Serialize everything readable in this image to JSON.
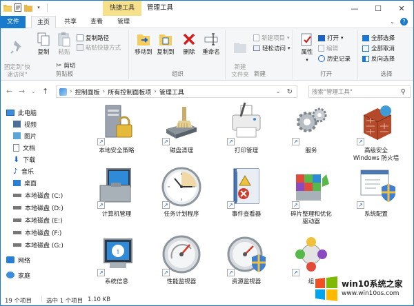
{
  "titlebar": {
    "context_tab": "快捷工具",
    "window_title": "管理工具"
  },
  "tabs": {
    "file": "文件",
    "home": "主页",
    "share": "共享",
    "view": "查看",
    "manage": "管理"
  },
  "ribbon": {
    "clipboard": {
      "pin": "固定到\"快\n速访问\"",
      "copy": "复制",
      "paste": "粘贴",
      "copy_path": "复制路径",
      "paste_shortcut": "粘贴快捷方式",
      "cut": "剪切",
      "label": "剪贴板"
    },
    "organize": {
      "move_to": "移动到",
      "copy_to": "复制到",
      "delete": "删除",
      "rename": "重命名",
      "label": "组织"
    },
    "new": {
      "new_folder": "新建\n文件夹",
      "new_item": "新建项目",
      "easy_access": "轻松访问",
      "label": "新建"
    },
    "open": {
      "properties": "属性",
      "open": "打开",
      "edit": "编辑",
      "history": "历史记录",
      "label": "打开"
    },
    "select": {
      "select_all": "全部选择",
      "select_none": "全部取消",
      "invert": "反向选择",
      "label": "选择"
    }
  },
  "address": {
    "crumbs": [
      "控制面板",
      "所有控制面板项",
      "管理工具"
    ],
    "search_placeholder": "搜索\"管理工具\""
  },
  "nav": {
    "items": [
      "此电脑",
      "视频",
      "图片",
      "文档",
      "下载",
      "音乐",
      "桌面",
      "本地磁盘 (C:)",
      "本地磁盘 (D:)",
      "本地磁盘 (E:)",
      "本地磁盘 (F:)",
      "本地磁盘 (G:)",
      "网络",
      "家庭"
    ]
  },
  "items": [
    {
      "label": "本地安全策略",
      "icon": "security-policy-icon"
    },
    {
      "label": "磁盘清理",
      "icon": "disk-cleanup-icon"
    },
    {
      "label": "打印管理",
      "icon": "print-management-icon"
    },
    {
      "label": "服务",
      "icon": "services-icon"
    },
    {
      "label": "高级安全\nWindows 防火墙",
      "icon": "firewall-icon"
    },
    {
      "label": "计算机管理",
      "icon": "computer-management-icon"
    },
    {
      "label": "任务计划程序",
      "icon": "task-scheduler-icon"
    },
    {
      "label": "事件查看器",
      "icon": "event-viewer-icon"
    },
    {
      "label": "碎片整理和优化\n驱动器",
      "icon": "defrag-icon"
    },
    {
      "label": "系统配置",
      "icon": "system-config-icon"
    },
    {
      "label": "系统信息",
      "icon": "system-info-icon"
    },
    {
      "label": "性能监视器",
      "icon": "performance-monitor-icon"
    },
    {
      "label": "资源监视器",
      "icon": "resource-monitor-icon"
    },
    {
      "label": "组",
      "icon": "component-services-icon"
    }
  ],
  "status": {
    "count": "19 个项目",
    "selected": "选中 1 个项目",
    "size": "1.10 KB"
  },
  "watermark": {
    "line1": "win10系统之家",
    "line2": "www.win10os.com"
  },
  "colors": {
    "accent": "#1979ca",
    "context_tab": "#f7e08a",
    "selection_border": "#d31d1d",
    "selection_fill": "#cce8ff"
  }
}
